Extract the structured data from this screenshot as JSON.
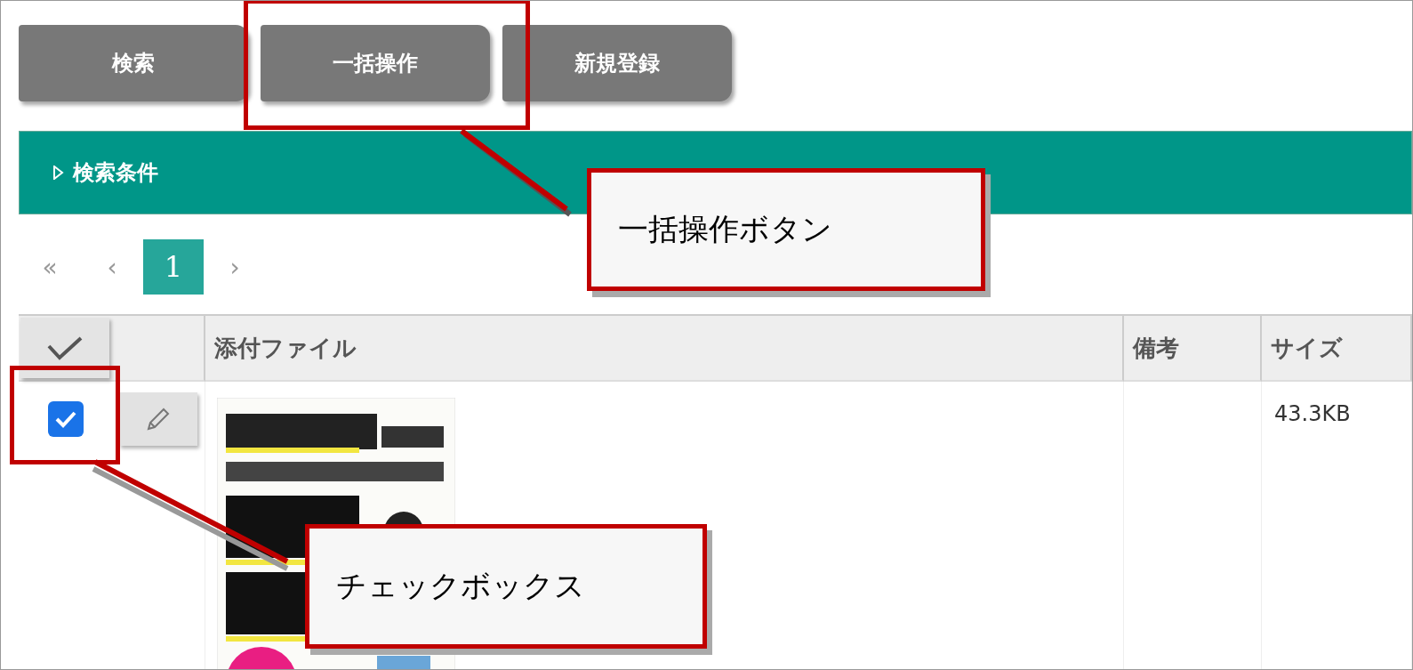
{
  "toolbar": {
    "buttons": [
      {
        "label": "検索"
      },
      {
        "label": "一括操作"
      },
      {
        "label": "新規登録"
      }
    ]
  },
  "search_panel": {
    "title": "検索条件",
    "expanded": false
  },
  "pager": {
    "items": [
      {
        "label": "«",
        "kind": "nav"
      },
      {
        "label": "‹",
        "kind": "nav"
      },
      {
        "label": "1",
        "kind": "page",
        "selected": true
      },
      {
        "label": "›",
        "kind": "nav"
      }
    ]
  },
  "table": {
    "columns": [
      "添付ファイル",
      "備考",
      "サイズ"
    ],
    "rows": [
      {
        "checked": true,
        "size": "43.3KB"
      }
    ]
  },
  "callouts": [
    {
      "text": "一括操作ボタン"
    },
    {
      "text": "チェックボックス"
    }
  ]
}
